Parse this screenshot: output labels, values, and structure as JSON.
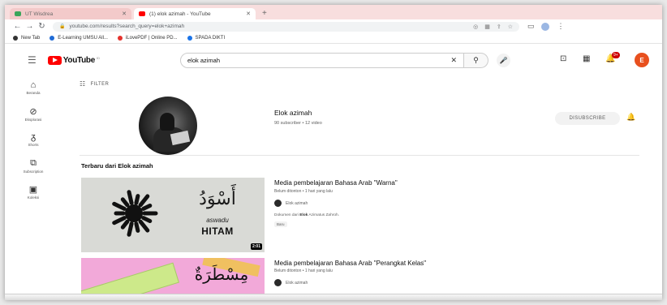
{
  "browser": {
    "tabs": [
      {
        "title": "UT Wisdrea",
        "active": false,
        "favicon": "green-square-icon"
      },
      {
        "title": "(1) elok azimah - YouTube",
        "active": true,
        "favicon": "youtube-icon"
      }
    ],
    "new_tab_glyph": "+",
    "url": "youtube.com/results?search_query=elok+azimah",
    "bookmarks": [
      {
        "label": "New Tab",
        "color": "#333333"
      },
      {
        "label": "E-Learning UMSU All...",
        "color": "#1f6bd6"
      },
      {
        "label": "iLovePDF | Online PD...",
        "color": "#e5322d"
      },
      {
        "label": "SPADA DIKTI",
        "color": "#1a73e8"
      }
    ]
  },
  "youtube": {
    "logo_text": "YouTube",
    "logo_region": "ID",
    "search_value": "elok azimah",
    "avatar_letter": "E",
    "avatar_color": "#e8501e",
    "notification_count": "9+",
    "guide": [
      {
        "label": "Beranda",
        "icon": "home-icon"
      },
      {
        "label": "Eksplorasi",
        "icon": "compass-icon"
      },
      {
        "label": "Shorts",
        "icon": "shorts-icon"
      },
      {
        "label": "Subscription",
        "icon": "subscriptions-icon"
      },
      {
        "label": "Koleksi",
        "icon": "library-icon"
      }
    ],
    "filter_label": "FILTER",
    "channel": {
      "name": "Elok azimah",
      "meta": "90 subscriber • 12 video",
      "subscribe_label": "DISUBSCRIBE"
    },
    "shelf_title": "Terbaru dari Elok azimah",
    "videos": [
      {
        "title": "Media pembelajaran Bahasa Arab \"Warna\"",
        "meta": "Belum ditonton • 1 hari yang lalu",
        "channel": "Elok azimah",
        "desc_prefix": "Dokumen dari ",
        "desc_bold": "Elok",
        "desc_suffix": " Azimatus Zahroh.",
        "badge": "Baru",
        "duration": "2:01",
        "thumb_arabic": "أَسْوَدُ",
        "thumb_translit": "aswadu",
        "thumb_word": "HITAM"
      },
      {
        "title": "Media pembelajaran Bahasa Arab \"Perangkat Kelas\"",
        "meta": "Belum ditonton • 1 hari yang lalu",
        "channel": "Elok azimah",
        "thumb_arabic": "مِسْطَرَةٌ"
      }
    ]
  }
}
